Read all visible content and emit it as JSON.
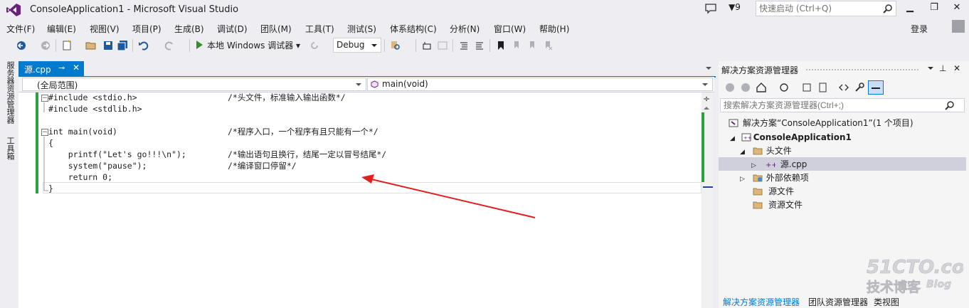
{
  "titlebar": {
    "title": "ConsoleApplication1 - Microsoft Visual Studio",
    "filter_count": "9",
    "quicklaunch_placeholder": "快速启动 (Ctrl+Q)",
    "minimize_glyph": "▁",
    "restore_glyph": "❐",
    "close_glyph": "✕"
  },
  "menu": [
    "文件(F)",
    "编辑(E)",
    "视图(V)",
    "项目(P)",
    "生成(B)",
    "调试(D)",
    "团队(M)",
    "工具(T)",
    "测试(S)",
    "体系结构(C)",
    "分析(N)",
    "窗口(W)",
    "帮助(H)"
  ],
  "login": "登录",
  "toolbar": {
    "run_label": "本地 Windows 调试器",
    "config": "Debug"
  },
  "side_tabs": [
    "服务器资源管理器",
    "工具箱"
  ],
  "editor": {
    "tab_name": "源.cpp",
    "tab_pin": "⊸",
    "tab_close": "✕",
    "scope": "(全局范围)",
    "member": "main(void)",
    "code": [
      {
        "code": "#include <stdio.h>",
        "comment": "/*头文件，标准输入输出函数*/"
      },
      {
        "code": "#include <stdlib.h>",
        "comment": ""
      },
      {
        "code": "",
        "comment": ""
      },
      {
        "code": "int main(void)",
        "comment": "/*程序入口，一个程序有且只能有一个*/"
      },
      {
        "code": "{",
        "comment": ""
      },
      {
        "code": "    printf(\"Let's go!!!\\n\");",
        "comment": "/*输出语句且换行，结尾一定以冒号结尾*/"
      },
      {
        "code": "    system(\"pause\");",
        "comment": "/*编译窗口停留*/"
      },
      {
        "code": "    return 0;",
        "comment": ""
      },
      {
        "code": "}",
        "comment": ""
      }
    ]
  },
  "solution_explorer": {
    "title": "解决方案资源管理器",
    "search_placeholder": "搜索解决方案资源管理器(Ctrl+;)",
    "tree": {
      "solution": "解决方案“ConsoleApplication1”(1 个项目)",
      "project": "ConsoleApplication1",
      "header_files": "头文件",
      "source_cpp": "源.cpp",
      "external_deps": "外部依赖项",
      "source_files": "源文件",
      "resource_files": "资源文件"
    },
    "bottom_tabs": [
      "解决方案资源管理器",
      "团队资源管理器",
      "类视图"
    ]
  },
  "watermark": {
    "line1": "51CTO.com",
    "line2": "技术博客",
    "line3": "Blog"
  },
  "colors": {
    "accent": "#007acc",
    "change_bar": "#2ea043",
    "annotation_arrow": "#e02020",
    "vs_purple": "#68217a"
  }
}
